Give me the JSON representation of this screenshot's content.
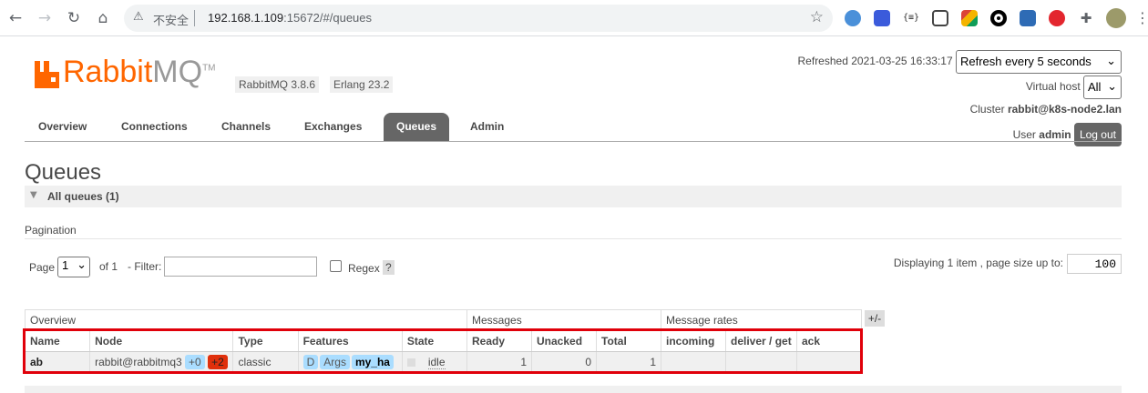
{
  "browser": {
    "security_text": "不安全",
    "url_host": "192.168.1.109",
    "url_path": ":15672/#/queues"
  },
  "brand": {
    "name_part1": "Rabbit",
    "name_part2": "MQ",
    "tm": "TM",
    "version": "RabbitMQ 3.8.6",
    "erlang": "Erlang 23.2",
    "colors": {
      "accent": "#ff6600",
      "tab_active": "#666666",
      "highlight": "#e0000a"
    }
  },
  "nav": {
    "tabs": [
      {
        "label": "Overview"
      },
      {
        "label": "Connections"
      },
      {
        "label": "Channels"
      },
      {
        "label": "Exchanges"
      },
      {
        "label": "Queues",
        "active": true
      },
      {
        "label": "Admin"
      }
    ]
  },
  "status": {
    "refreshed_label": "Refreshed 2021-03-25 16:33:17",
    "refresh_select": "Refresh every 5 seconds",
    "vhost_label": "Virtual host",
    "vhost_value": "All",
    "cluster_label": "Cluster",
    "cluster_value": "rabbit@k8s-node2.lan",
    "user_label": "User",
    "user_value": "admin",
    "logout": "Log out"
  },
  "page": {
    "title": "Queues",
    "section": "All queues (1)",
    "pagination_label": "Pagination",
    "page_label": "Page",
    "page_value": "1",
    "of_label": "of 1",
    "filter_label": "- Filter:",
    "filter_value": "",
    "regex_label": "Regex",
    "regex_help": "?",
    "display_info": "Displaying 1 item , page size up to:",
    "page_size": "100",
    "plusminus": "+/-"
  },
  "table": {
    "group_headers": [
      "Overview",
      "Messages",
      "Message rates"
    ],
    "columns": [
      "Name",
      "Node",
      "Type",
      "Features",
      "State",
      "Ready",
      "Unacked",
      "Total",
      "incoming",
      "deliver / get",
      "ack"
    ],
    "row": {
      "name": "ab",
      "node": "rabbit@rabbitmq3",
      "node_badge1": "+0",
      "node_badge2": "+2",
      "type": "classic",
      "features": [
        "D",
        "Args",
        "my_ha"
      ],
      "state": "idle",
      "ready": "1",
      "unacked": "0",
      "total": "1",
      "incoming": "",
      "deliver_get": "",
      "ack": ""
    }
  }
}
